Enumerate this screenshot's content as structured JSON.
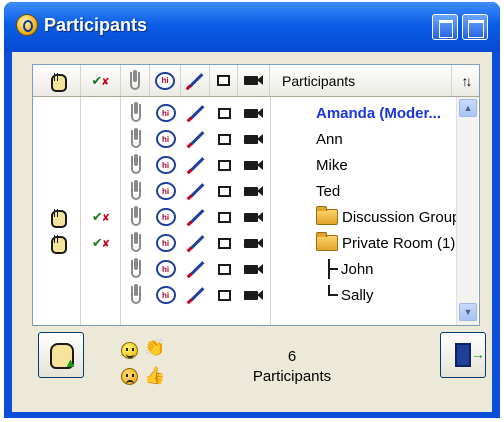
{
  "window": {
    "title": "Participants"
  },
  "header": {
    "participants_label": "Participants",
    "sort_icon": "sort-arrows-icon"
  },
  "participants": [
    {
      "name": "Amanda (Moder...",
      "moderator": true,
      "hand": false,
      "checked": false,
      "folder": false,
      "tree": ""
    },
    {
      "name": "Ann",
      "moderator": false,
      "hand": false,
      "checked": false,
      "folder": false,
      "tree": ""
    },
    {
      "name": "Mike",
      "moderator": false,
      "hand": false,
      "checked": false,
      "folder": false,
      "tree": ""
    },
    {
      "name": "Ted",
      "moderator": false,
      "hand": false,
      "checked": false,
      "folder": false,
      "tree": ""
    },
    {
      "name": "Discussion Group",
      "moderator": false,
      "hand": true,
      "checked": true,
      "folder": true,
      "tree": ""
    },
    {
      "name": "Private Room (1)",
      "moderator": false,
      "hand": true,
      "checked": true,
      "folder": true,
      "tree": ""
    },
    {
      "name": "John",
      "moderator": false,
      "hand": false,
      "checked": false,
      "folder": false,
      "tree": "branch"
    },
    {
      "name": "Sally",
      "moderator": false,
      "hand": false,
      "checked": false,
      "folder": false,
      "tree": "last"
    }
  ],
  "footer": {
    "count": "6",
    "count_label": "Participants"
  }
}
